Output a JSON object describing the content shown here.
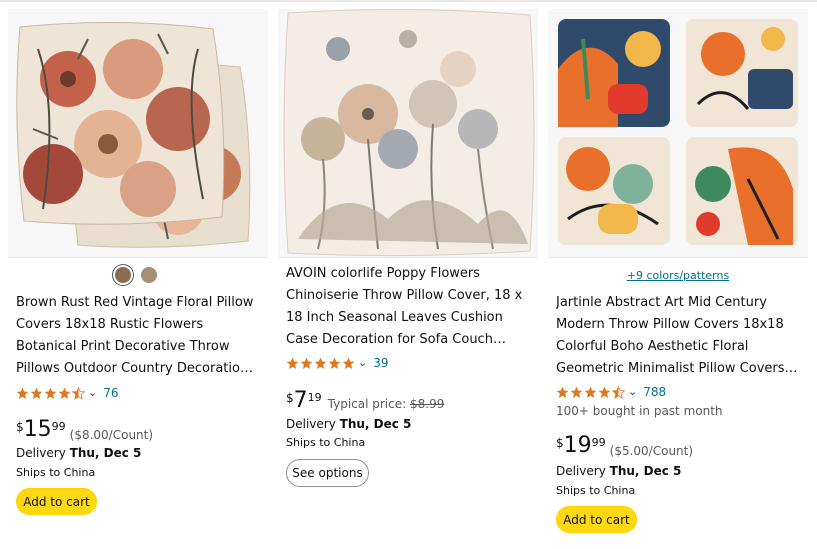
{
  "colors": {
    "star": "#de7921",
    "link": "#007185",
    "cart": "#ffd814",
    "text": "#0f1111",
    "muted": "#565959"
  },
  "products": [
    {
      "swatch_count": 2,
      "title_lines": [
        "Brown Rust Red Vintage Floral Pillow",
        "Covers 18x18 Rustic Flowers",
        "Botanical Print Decorative Throw",
        "Pillows Outdoor Country Decoratio…"
      ],
      "rating": 4.5,
      "rating_count": "76",
      "price_symbol": "$",
      "price_whole": "15",
      "price_fraction": "99",
      "unit_price": "($8.00/Count)",
      "delivery_label": "Delivery",
      "delivery_date": "Thu, Dec 5",
      "ships_to": "Ships to China",
      "button_label": "Add to cart"
    },
    {
      "title_lines": [
        "AVOIN colorlife Poppy Flowers",
        "Chinoiserie Throw Pillow Cover, 18 x",
        "18 Inch Seasonal Leaves Cushion",
        "Case Decoration for Sofa Couch…"
      ],
      "rating": 5,
      "rating_count": "39",
      "price_symbol": "$",
      "price_whole": "7",
      "price_fraction": "19",
      "typical_label": "Typical price:",
      "typical_price": "$8.99",
      "delivery_label": "Delivery",
      "delivery_date": "Thu, Dec 5",
      "ships_to": "Ships to China",
      "button_label": "See options"
    },
    {
      "colors_link": "+9 colors/patterns",
      "title_lines": [
        "Jartinle Abstract Art Mid Century",
        "Modern Throw Pillow Covers 18x18",
        "Colorful Boho Aesthetic Floral",
        "Geometric Minimalist Pillow Covers…"
      ],
      "rating": 4.5,
      "rating_count": "788",
      "bought_text": "100+ bought in past month",
      "price_symbol": "$",
      "price_whole": "19",
      "price_fraction": "99",
      "unit_price": "($5.00/Count)",
      "delivery_label": "Delivery",
      "delivery_date": "Thu, Dec 5",
      "ships_to": "Ships to China",
      "button_label": "Add to cart"
    }
  ]
}
